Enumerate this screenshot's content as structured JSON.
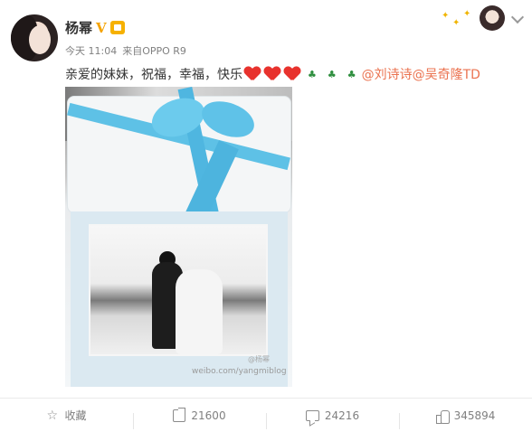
{
  "post": {
    "username": "杨幂",
    "time": "今天 11:04",
    "source": "来自OPPO R9",
    "text": "亲爱的妹妹，祝福，幸福，快乐",
    "mentions": [
      "@刘诗诗",
      "@吴奇隆TD"
    ],
    "image": {
      "watermark": "weibo.com/yangmiblog",
      "watermark_handle": "@杨幂"
    }
  },
  "actions": {
    "favorite_label": "收藏",
    "share_count": "21600",
    "comment_count": "24216",
    "like_count": "345894"
  },
  "colors": {
    "accent": "#eb7350",
    "heart": "#e8322d",
    "verified": "#f5a300",
    "ribbon": "#5ec1e6"
  },
  "icons": {
    "verified": "verified-v-icon",
    "member": "member-crown-icon",
    "favorite": "star-icon",
    "share": "share-icon",
    "comment": "comment-icon",
    "like": "thumbs-up-icon"
  }
}
